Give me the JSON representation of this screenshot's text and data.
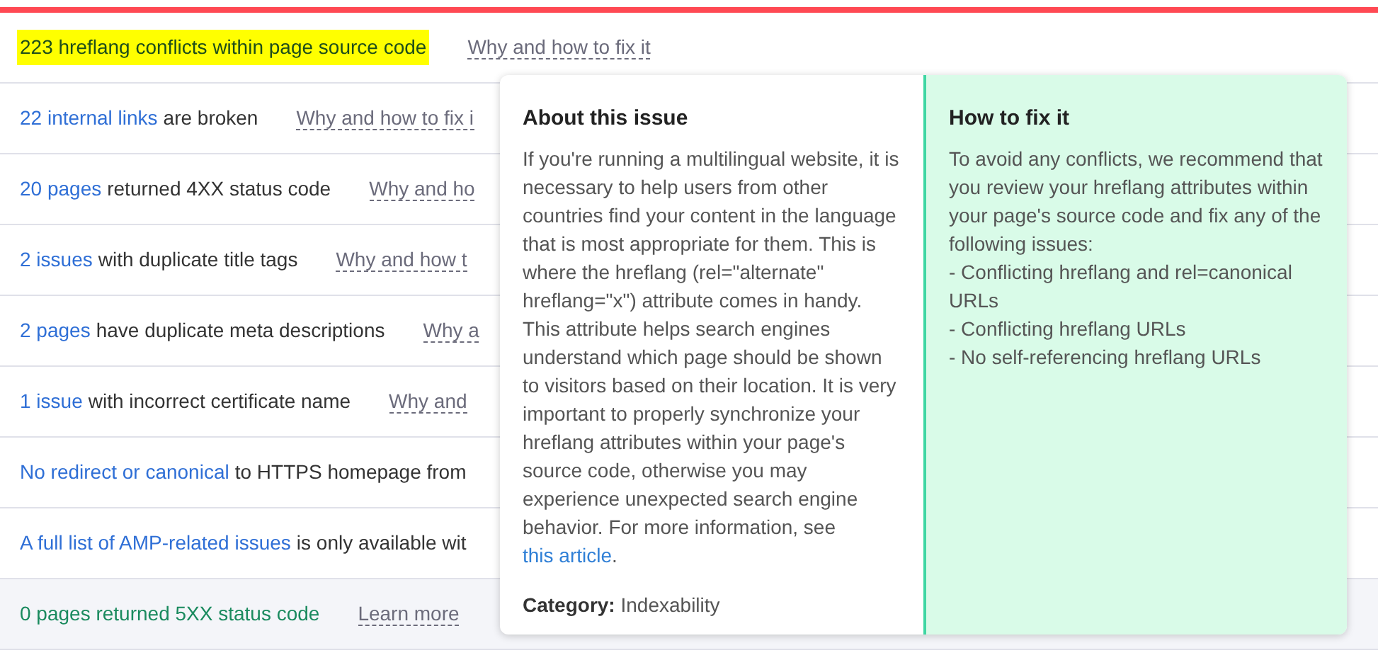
{
  "rows": [
    {
      "kind": "marked",
      "link_text": "223 hreflang conflicts within page source code",
      "text": "",
      "help_link": "Why and how to fix it"
    },
    {
      "kind": "issue",
      "link_text": "22 internal links",
      "text": "are broken",
      "help_link": "Why and how to fix i"
    },
    {
      "kind": "issue",
      "link_text": "20 pages",
      "text": "returned 4XX status code",
      "help_link": "Why and ho"
    },
    {
      "kind": "issue",
      "link_text": "2 issues",
      "text": "with duplicate title tags",
      "help_link": "Why and how t"
    },
    {
      "kind": "issue",
      "link_text": "2 pages",
      "text": "have duplicate meta descriptions",
      "help_link": "Why a"
    },
    {
      "kind": "issue",
      "link_text": "1 issue",
      "text": "with incorrect certificate name",
      "help_link": "Why and"
    },
    {
      "kind": "issue",
      "link_text": "No redirect or canonical",
      "text": "to HTTPS homepage from",
      "help_link": ""
    },
    {
      "kind": "issue",
      "link_text": "A full list of AMP-related issues",
      "text": "is only available wit",
      "help_link": ""
    },
    {
      "kind": "passed",
      "link_text": "0 pages returned 5XX status code",
      "text": "",
      "help_link": "Learn more"
    }
  ],
  "popover": {
    "about": {
      "title": "About this issue",
      "body": "If you're running a multilingual website, it is necessary to help users from other countries find your content in the language that is most appropriate for them. This is where the hreflang (rel=\"alternate\" hreflang=\"x\") attribute comes in handy. This attribute helps search engines understand which page should be shown to visitors based on their location. It is very important to properly synchronize your hreflang attributes within your page's source code, otherwise you may experience unexpected search engine behavior. For more information, see",
      "link": "this article",
      "after_link": ".",
      "category_label": "Category:",
      "category": "Indexability"
    },
    "fix": {
      "title": "How to fix it",
      "lines": [
        "To avoid any conflicts, we recommend that you review your hreflang attributes within your page's source code and fix any of the following issues:",
        "- Conflicting hreflang and rel=canonical URLs",
        "- Conflicting hreflang URLs",
        "- No self-referencing hreflang URLs"
      ]
    }
  }
}
